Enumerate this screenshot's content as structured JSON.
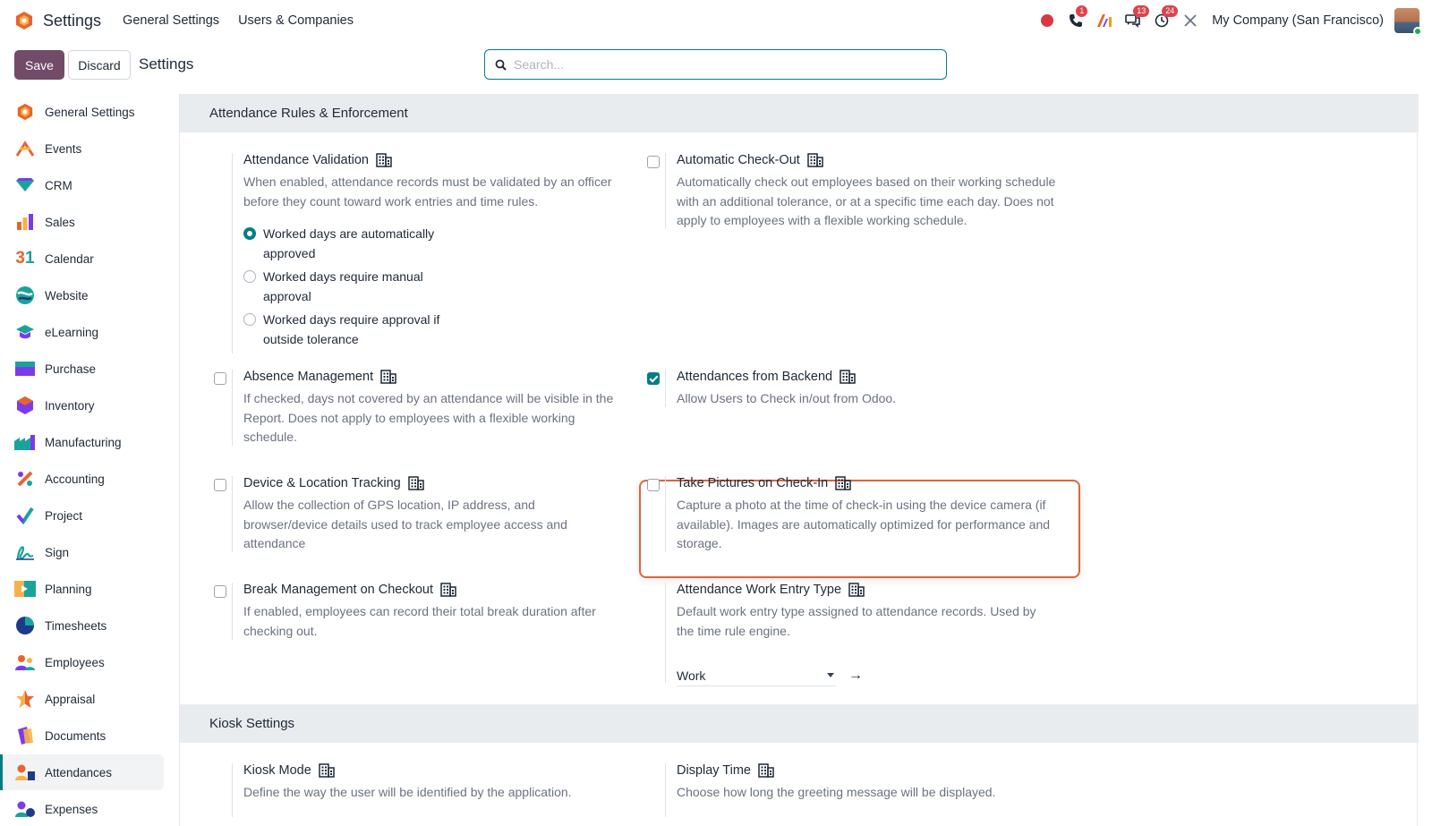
{
  "nav": {
    "app_title": "Settings",
    "links": [
      "General Settings",
      "Users & Companies"
    ],
    "company": "My Company (San Francisco)",
    "badges": {
      "phone": "1",
      "messages": "13",
      "activities": "24"
    }
  },
  "control": {
    "save_label": "Save",
    "discard_label": "Discard",
    "breadcrumb": "Settings",
    "search_placeholder": "Search..."
  },
  "sidebar": {
    "items": [
      {
        "label": "General Settings",
        "icon": "odoo-settings-icon"
      },
      {
        "label": "Events",
        "icon": "events-icon"
      },
      {
        "label": "CRM",
        "icon": "crm-icon"
      },
      {
        "label": "Sales",
        "icon": "sales-icon"
      },
      {
        "label": "Calendar",
        "icon": "calendar-icon"
      },
      {
        "label": "Website",
        "icon": "website-icon"
      },
      {
        "label": "eLearning",
        "icon": "elearning-icon"
      },
      {
        "label": "Purchase",
        "icon": "purchase-icon"
      },
      {
        "label": "Inventory",
        "icon": "inventory-icon"
      },
      {
        "label": "Manufacturing",
        "icon": "manufacturing-icon"
      },
      {
        "label": "Accounting",
        "icon": "accounting-icon"
      },
      {
        "label": "Project",
        "icon": "project-icon"
      },
      {
        "label": "Sign",
        "icon": "sign-icon"
      },
      {
        "label": "Planning",
        "icon": "planning-icon"
      },
      {
        "label": "Timesheets",
        "icon": "timesheets-icon"
      },
      {
        "label": "Employees",
        "icon": "employees-icon"
      },
      {
        "label": "Appraisal",
        "icon": "appraisal-icon"
      },
      {
        "label": "Documents",
        "icon": "documents-icon"
      },
      {
        "label": "Attendances",
        "icon": "attendances-icon",
        "active": true
      },
      {
        "label": "Expenses",
        "icon": "expenses-icon"
      }
    ]
  },
  "sections": {
    "rules": {
      "title": "Attendance Rules & Enforcement",
      "validation": {
        "title": "Attendance Validation",
        "desc": "When enabled, attendance records must be validated by an officer before they count toward work entries and time rules.",
        "options": [
          {
            "label": "Worked days are automatically approved",
            "selected": true
          },
          {
            "label": "Worked days require manual approval",
            "selected": false
          },
          {
            "label": "Worked days require approval if outside tolerance",
            "selected": false
          }
        ]
      },
      "auto_checkout": {
        "title": "Automatic Check-Out",
        "desc": "Automatically check out employees based on their working schedule with an additional tolerance, or at a specific time each day. Does not apply to employees with a flexible working schedule.",
        "checked": false
      },
      "absence": {
        "title": "Absence Management",
        "desc": "If checked, days not covered by an attendance will be visible in the Report. Does not apply to employees with a flexible working schedule.",
        "checked": false
      },
      "backend": {
        "title": "Attendances from Backend",
        "desc": "Allow Users to Check in/out from Odoo.",
        "checked": true
      },
      "tracking": {
        "title": "Device & Location Tracking",
        "desc": "Allow the collection of GPS location, IP address, and browser/device details used to track employee access and attendance",
        "checked": false
      },
      "pictures": {
        "title": "Take Pictures on Check-In",
        "desc": "Capture a photo at the time of check-in using the device camera (if available). Images are automatically optimized for performance and storage.",
        "checked": false
      },
      "break": {
        "title": "Break Management on Checkout",
        "desc": "If enabled, employees can record their total break duration after checking out.",
        "checked": false
      },
      "work_entry": {
        "title": "Attendance Work Entry Type",
        "desc": "Default work entry type assigned to attendance records. Used by the time rule engine.",
        "value": "Work"
      }
    },
    "kiosk": {
      "title": "Kiosk Settings",
      "mode": {
        "title": "Kiosk Mode",
        "desc": "Define the way the user will be identified by the application."
      },
      "display_time": {
        "title": "Display Time",
        "desc": "Choose how long the greeting message will be displayed."
      }
    }
  },
  "colors": {
    "brand": "#714b67",
    "accent": "#017e84",
    "highlight": "#d9673c",
    "badge": "#e0424b"
  }
}
